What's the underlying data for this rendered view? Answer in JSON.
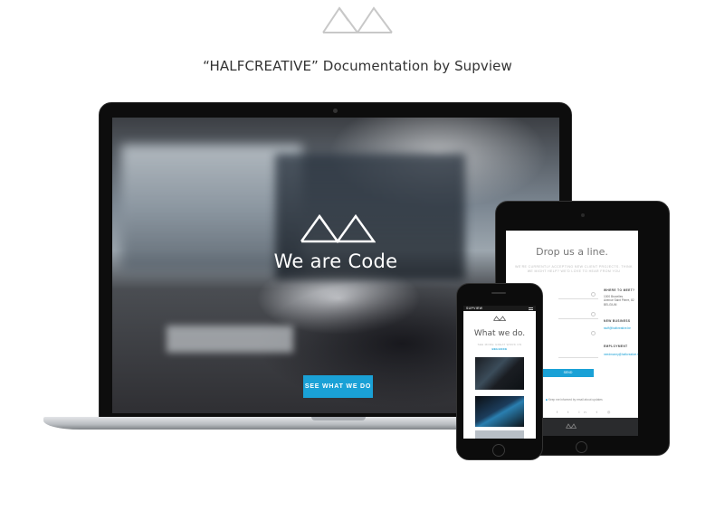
{
  "header": {
    "logo_icon": "mountains-logo-icon",
    "title": "“HALFCREATIVE” Documentation by Supview"
  },
  "laptop": {
    "hero_logo_icon": "mountains-logo-icon",
    "hero_title": "We are Code",
    "hero_button": "SEE WHAT WE DO"
  },
  "tablet": {
    "title": "Drop us a line.",
    "subtitle": "WE'RE CURRENTLY ACCEPTING NEW CLIENT PROJECTS. THINK WE MIGHT HELP? WE'D LOVE TO HEAR FROM YOU",
    "send_button": "SEND",
    "where_heading": "WHERE TO MEET?",
    "address_lines": [
      "1000 Bruxelles",
      "Avenue Saint Pierre, 82",
      "BELGIUM"
    ],
    "new_business_heading": "NEW BUSINESS",
    "new_business_email": "stuff@halfcreative.be",
    "employment_heading": "EMPLOYMENT",
    "employment_email": "needmoney@halfcreative.be",
    "newsletter_checkbox": "Keep me informed by email about updates",
    "social_icons": [
      "facebook-icon",
      "twitter-icon",
      "linkedin-icon",
      "tumblr-icon",
      "instagram-icon"
    ],
    "social_glyphs": "f t in t ◎",
    "footer_logo_icon": "mountains-logo-icon"
  },
  "phone": {
    "brand": "SUPVIEW",
    "menu_icon": "hamburger-menu-icon",
    "logo_icon": "mountains-logo-icon",
    "title": "What we do.",
    "subtitle": "SEE MORE GREAT WORK ON",
    "link": "BEHANCE"
  },
  "colors": {
    "accent": "#1aa1d6",
    "device_frame": "#0c0c0c",
    "text_gray": "#777777"
  }
}
